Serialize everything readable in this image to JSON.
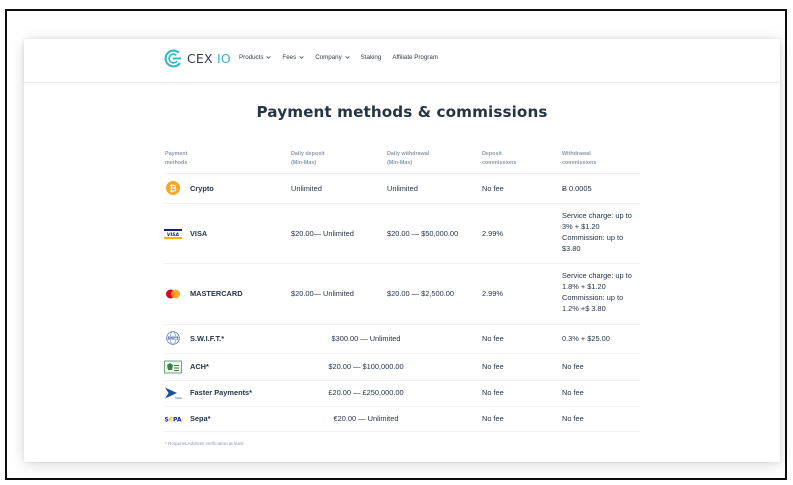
{
  "header": {
    "logo_text_main": "CEX",
    "logo_text_accent": "IO",
    "nav": [
      {
        "label": "Products",
        "dropdown": true
      },
      {
        "label": "Fees",
        "dropdown": true
      },
      {
        "label": "Company",
        "dropdown": true
      },
      {
        "label": "Staking",
        "dropdown": false
      },
      {
        "label": "Affiliate Program",
        "dropdown": false
      }
    ]
  },
  "page": {
    "title": "Payment methods & commissions",
    "footnote": "* Requires Address verification at least"
  },
  "table": {
    "headers": {
      "method": "Payment\nmethods",
      "deposit": "Daily deposit\n(Min-Max)",
      "withdrawal": "Daily withdrawal\n(Min-Max)",
      "dep_comm": "Deposit\ncommissions",
      "wd_comm": "Withdrawal\ncommissions"
    },
    "rows": [
      {
        "icon": "bitcoin-icon",
        "name": "Crypto",
        "deposit": "Unlimited",
        "withdrawal": "Unlimited",
        "dep_comm": "No fee",
        "wd_comm": "Ƀ 0.0005"
      },
      {
        "icon": "visa-icon",
        "name": "VISA",
        "deposit": "$20.00— Unlimited",
        "withdrawal": "$20.00 — $50,000.00",
        "dep_comm": "2.99%",
        "wd_comm": "Service charge: up to\n3% + $1.20\nCommission: up to\n$3.80"
      },
      {
        "icon": "mastercard-icon",
        "name": "MASTERCARD",
        "deposit": "$20.00— Unlimited",
        "withdrawal": "$20.00 — $2,500.00",
        "dep_comm": "2.99%",
        "wd_comm": "Service charge: up to\n1.8% + $1.20\nCommission: up to\n1.2% +$ 3.80"
      },
      {
        "icon": "swift-icon",
        "name": "S.W.I.F.T.*",
        "combined": "$300.00 — Unlimited",
        "dep_comm": "No fee",
        "wd_comm": "0.3% + $25.00"
      },
      {
        "icon": "ach-icon",
        "name": "ACH*",
        "combined": "$20.00 — $100,000.00",
        "dep_comm": "No fee",
        "wd_comm": "No fee"
      },
      {
        "icon": "faster-payments-icon",
        "name": "Faster Payments*",
        "combined": "£20.00 — £250,000.00",
        "dep_comm": "No fee",
        "wd_comm": "No fee"
      },
      {
        "icon": "sepa-icon",
        "name": "Sepa*",
        "combined": "€20.00 — Unlimited",
        "dep_comm": "No fee",
        "wd_comm": "No fee"
      }
    ]
  },
  "colors": {
    "accent": "#39b5c6",
    "text": "#263445",
    "muted": "#8e9aa8",
    "bitcoin": "#f7a52b",
    "visa_blue": "#1a1f71",
    "visa_gold": "#f7b600",
    "mc_red": "#eb001b",
    "mc_orange": "#f79e1b"
  }
}
